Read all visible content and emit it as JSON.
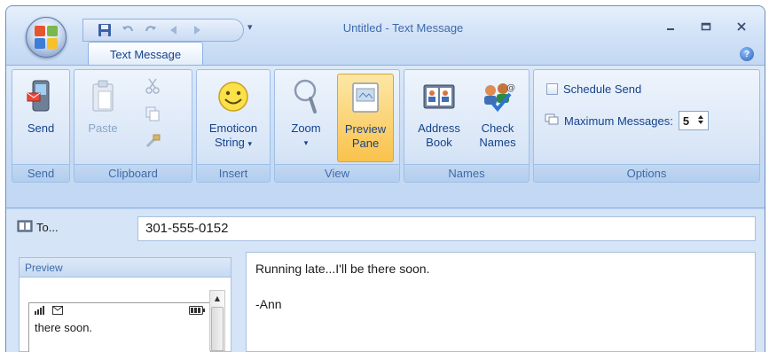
{
  "window": {
    "title": "Untitled - Text Message"
  },
  "quick_access": {
    "buttons": [
      "save-icon",
      "undo-icon",
      "redo-icon",
      "previous-icon",
      "next-icon"
    ],
    "dropdown": "▾"
  },
  "tabs": [
    {
      "label": "Text Message",
      "active": true
    }
  ],
  "ribbon": {
    "groups": {
      "send": {
        "label": "Send",
        "button": "Send"
      },
      "clipboard": {
        "label": "Clipboard",
        "paste": "Paste"
      },
      "insert": {
        "label": "Insert",
        "emoticon_line1": "Emoticon",
        "emoticon_line2": "String"
      },
      "view": {
        "label": "View",
        "zoom": "Zoom",
        "preview_line1": "Preview",
        "preview_line2": "Pane"
      },
      "names": {
        "label": "Names",
        "address_line1": "Address",
        "address_line2": "Book",
        "check_line1": "Check",
        "check_line2": "Names"
      },
      "options": {
        "label": "Options",
        "schedule_send": "Schedule Send",
        "max_messages_label": "Maximum Messages:",
        "max_messages_value": "5"
      }
    }
  },
  "address": {
    "to_label": "To...",
    "to_value": "301-555-0152"
  },
  "preview": {
    "header": "Preview",
    "phone_text": "there soon."
  },
  "message": {
    "lines": [
      "Running late...I'll be there soon.",
      "",
      "-Ann"
    ]
  },
  "colors": {
    "ribbon_bg": "#c7dbf4",
    "active_button": "#fbd57a",
    "text": "#15428b"
  }
}
